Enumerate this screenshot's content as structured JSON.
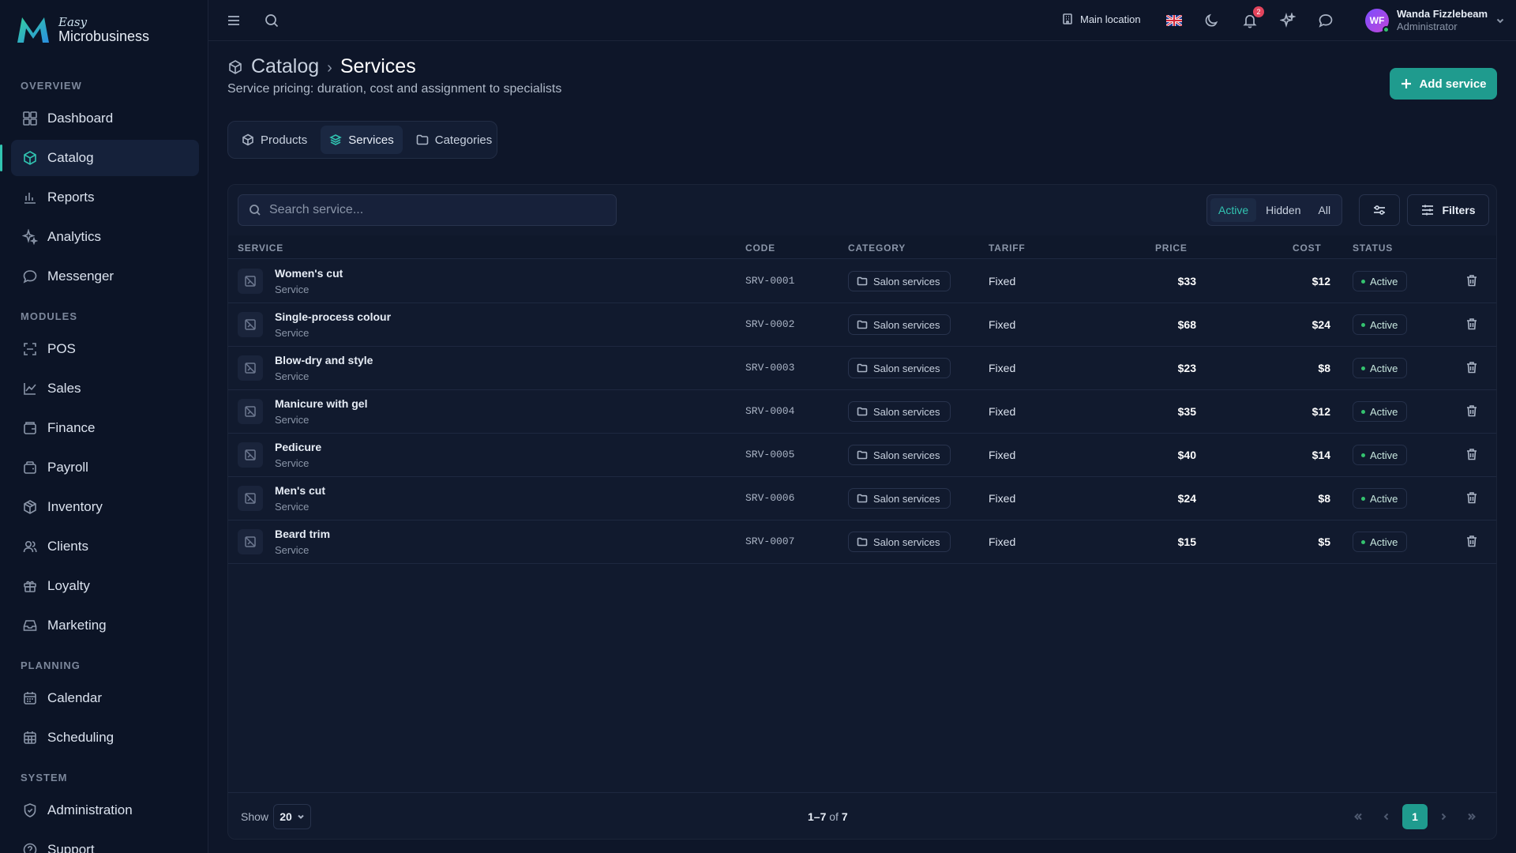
{
  "brand": {
    "easy": "Easy",
    "name": "Microbusiness"
  },
  "sidebar": {
    "sections": {
      "overview": "OVERVIEW",
      "modules": "MODULES",
      "planning": "PLANNING",
      "system": "SYSTEM"
    },
    "items": {
      "dashboard": "Dashboard",
      "catalog": "Catalog",
      "reports": "Reports",
      "analytics": "Analytics",
      "messenger": "Messenger",
      "pos": "POS",
      "sales": "Sales",
      "finance": "Finance",
      "payroll": "Payroll",
      "inventory": "Inventory",
      "clients": "Clients",
      "loyalty": "Loyalty",
      "marketing": "Marketing",
      "calendar": "Calendar",
      "scheduling": "Scheduling",
      "administration": "Administration",
      "support": "Support"
    },
    "active": "catalog"
  },
  "topbar": {
    "location": "Main location",
    "notifications_count": "2",
    "user": {
      "initials": "WF",
      "name": "Wanda Fizzlebeam",
      "role": "Administrator"
    }
  },
  "header": {
    "breadcrumb_parent": "Catalog",
    "breadcrumb_sep": "›",
    "title": "Services",
    "subtitle": "Service pricing: duration, cost and assignment to specialists",
    "add_button": "Add service"
  },
  "tabs": {
    "products": "Products",
    "services": "Services",
    "categories": "Categories",
    "active": "services"
  },
  "toolbar": {
    "search_placeholder": "Search service...",
    "segments": {
      "active": "Active",
      "hidden": "Hidden",
      "all": "All"
    },
    "filters_label": "Filters"
  },
  "table": {
    "columns": {
      "service": "SERVICE",
      "code": "CODE",
      "category": "CATEGORY",
      "tariff": "TARIFF",
      "price": "PRICE",
      "cost": "COST",
      "status": "STATUS"
    },
    "rows": [
      {
        "name": "Women's cut",
        "type": "Service",
        "code": "SRV-0001",
        "category": "Salon services",
        "tariff": "Fixed",
        "price": "$33",
        "cost": "$12",
        "status": "Active"
      },
      {
        "name": "Single-process colour",
        "type": "Service",
        "code": "SRV-0002",
        "category": "Salon services",
        "tariff": "Fixed",
        "price": "$68",
        "cost": "$24",
        "status": "Active"
      },
      {
        "name": "Blow-dry and style",
        "type": "Service",
        "code": "SRV-0003",
        "category": "Salon services",
        "tariff": "Fixed",
        "price": "$23",
        "cost": "$8",
        "status": "Active"
      },
      {
        "name": "Manicure with gel",
        "type": "Service",
        "code": "SRV-0004",
        "category": "Salon services",
        "tariff": "Fixed",
        "price": "$35",
        "cost": "$12",
        "status": "Active"
      },
      {
        "name": "Pedicure",
        "type": "Service",
        "code": "SRV-0005",
        "category": "Salon services",
        "tariff": "Fixed",
        "price": "$40",
        "cost": "$14",
        "status": "Active"
      },
      {
        "name": "Men's cut",
        "type": "Service",
        "code": "SRV-0006",
        "category": "Salon services",
        "tariff": "Fixed",
        "price": "$24",
        "cost": "$8",
        "status": "Active"
      },
      {
        "name": "Beard trim",
        "type": "Service",
        "code": "SRV-0007",
        "category": "Salon services",
        "tariff": "Fixed",
        "price": "$15",
        "cost": "$5",
        "status": "Active"
      }
    ]
  },
  "footer": {
    "show_label": "Show",
    "page_size": "20",
    "range": "1–7",
    "of": "of",
    "total": "7",
    "current_page": "1"
  },
  "colors": {
    "accent": "#31c4b1",
    "primary_button": "#1f9b8e",
    "background": "#0e1629",
    "status_dot": "#34c26f",
    "badge": "#e2445c"
  }
}
